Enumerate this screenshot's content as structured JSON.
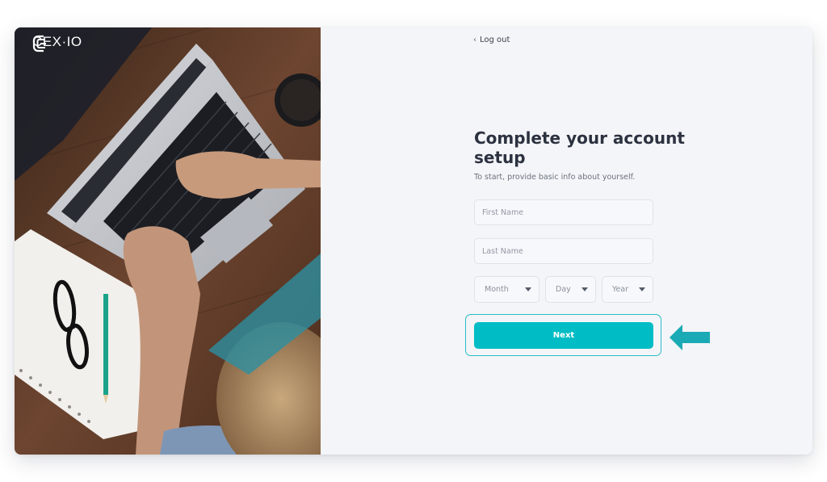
{
  "brand": {
    "name": "CEX·IO"
  },
  "nav": {
    "logout_label": "Log out"
  },
  "form": {
    "title": "Complete your account setup",
    "subtitle": "To start, provide basic info about yourself.",
    "first_name_placeholder": "First Name",
    "last_name_placeholder": "Last Name",
    "month_label": "Month",
    "day_label": "Day",
    "year_label": "Year",
    "next_label": "Next"
  },
  "colors": {
    "accent": "#00bcc4",
    "highlight_outline": "#28bcc6",
    "annotation_arrow": "#1aaab5",
    "panel_bg": "#f4f5f8"
  },
  "icons": {
    "logo": "cex-logo-icon",
    "back": "chevron-left-icon",
    "dropdown": "caret-down-icon",
    "annotation": "arrow-left-icon"
  }
}
